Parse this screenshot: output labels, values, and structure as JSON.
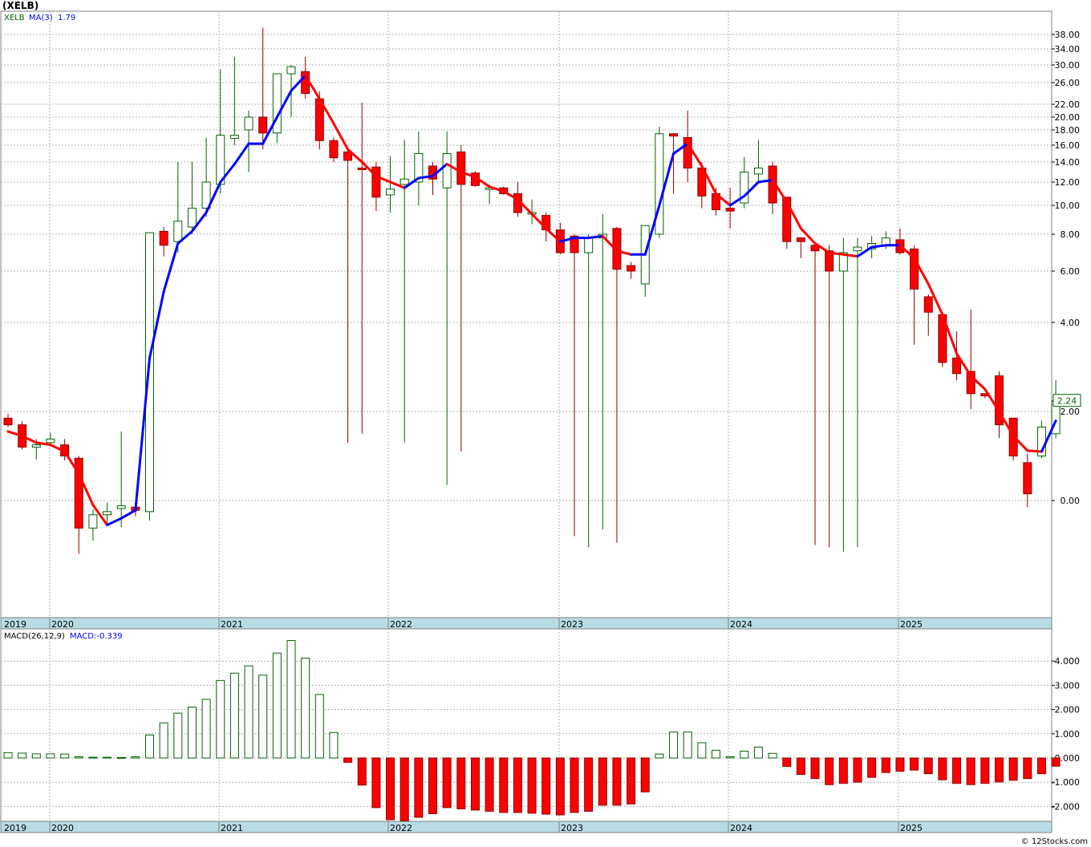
{
  "header": {
    "title": "(XELB)"
  },
  "credit": "© 12Stocks.com",
  "chart_data": [
    {
      "type": "candlestick",
      "ticker": "XELB",
      "ma_label": "MA(3)",
      "ma_value": "1.79",
      "last_price_label": "2.24",
      "y_scale": "custom-compressed",
      "y_ticks": [
        {
          "v": 0,
          "label": "0.00"
        },
        {
          "v": 2,
          "label": "2.00"
        },
        {
          "v": 4,
          "label": "4.00"
        },
        {
          "v": 6,
          "label": "6.00"
        },
        {
          "v": 8,
          "label": "8.00"
        },
        {
          "v": 10,
          "label": "10.00"
        },
        {
          "v": 12,
          "label": "12.00"
        },
        {
          "v": 14,
          "label": "14.00"
        },
        {
          "v": 16,
          "label": "16.00"
        },
        {
          "v": 18,
          "label": "18.00"
        },
        {
          "v": 20,
          "label": "20.00"
        },
        {
          "v": 22,
          "label": "22.00"
        },
        {
          "v": 26,
          "label": "26.00"
        },
        {
          "v": 30,
          "label": "30.00"
        },
        {
          "v": 34,
          "label": "34.00"
        },
        {
          "v": 38,
          "label": "38.00"
        }
      ],
      "x_labels": [
        "2019",
        "2020",
        "2021",
        "2022",
        "2023",
        "2024",
        "2025"
      ],
      "colors": {
        "up": "#006400",
        "down": "#ff0000",
        "ma_up": "#0000ff",
        "ma_down": "#ff0000",
        "grid": "#b0b0b0",
        "axis_band": "#b8dce4"
      },
      "candles": [
        [
          1.85,
          1.95,
          1.65,
          1.7
        ],
        [
          1.7,
          1.78,
          1.15,
          1.2
        ],
        [
          1.2,
          1.38,
          0.92,
          1.25
        ],
        [
          1.3,
          1.52,
          1.22,
          1.38
        ],
        [
          1.25,
          1.38,
          0.9,
          1.0
        ],
        [
          0.95,
          1.0,
          -1.2,
          -0.62
        ],
        [
          -0.62,
          -0.2,
          -0.9,
          -0.32
        ],
        [
          -0.32,
          -0.05,
          -0.55,
          -0.25
        ],
        [
          -0.18,
          1.55,
          -0.6,
          -0.12
        ],
        [
          -0.15,
          -0.05,
          -0.35,
          -0.22
        ],
        [
          -0.25,
          7.8,
          -0.45,
          8.1
        ],
        [
          8.2,
          8.5,
          6.8,
          7.4
        ],
        [
          7.6,
          14.0,
          7.0,
          8.9
        ],
        [
          8.5,
          14.0,
          8.0,
          9.8
        ],
        [
          9.8,
          17.0,
          9.2,
          12.0
        ],
        [
          11.8,
          29.0,
          11.0,
          17.3
        ],
        [
          16.9,
          32.0,
          16.0,
          17.3
        ],
        [
          18.0,
          21.0,
          13.0,
          20.0
        ],
        [
          20.0,
          40.0,
          15.5,
          17.6
        ],
        [
          17.6,
          28.0,
          16.3,
          28.0
        ],
        [
          28.0,
          30.0,
          20.0,
          29.6
        ],
        [
          28.5,
          32.0,
          23.0,
          24.0
        ],
        [
          23.0,
          24.4,
          15.5,
          16.6
        ],
        [
          16.6,
          17.0,
          14.0,
          14.5
        ],
        [
          15.2,
          15.5,
          1.3,
          14.2
        ],
        [
          13.4,
          22.3,
          1.5,
          13.3
        ],
        [
          13.5,
          14.0,
          9.6,
          10.7
        ],
        [
          10.9,
          14.7,
          9.5,
          11.4
        ],
        [
          11.8,
          16.7,
          1.3,
          12.3
        ],
        [
          12.0,
          17.8,
          10.0,
          15.0
        ],
        [
          13.6,
          14.0,
          10.9,
          12.3
        ],
        [
          11.5,
          17.8,
          0.35,
          15.0
        ],
        [
          15.2,
          16.0,
          1.1,
          11.8
        ],
        [
          12.9,
          13.1,
          11.6,
          11.7
        ],
        [
          11.5,
          11.8,
          10.1,
          11.5
        ],
        [
          11.5,
          11.6,
          10.9,
          11.0
        ],
        [
          11.0,
          12.0,
          9.2,
          9.5
        ],
        [
          9.5,
          10.5,
          8.7,
          9.5
        ],
        [
          9.3,
          9.5,
          7.6,
          8.3
        ],
        [
          8.3,
          8.8,
          6.9,
          7.0
        ],
        [
          7.9,
          8.0,
          -0.8,
          7.0
        ],
        [
          7.0,
          8.0,
          -1.05,
          7.8
        ],
        [
          7.8,
          9.4,
          -0.65,
          8.0
        ],
        [
          8.4,
          8.5,
          -0.95,
          6.1
        ],
        [
          6.3,
          6.5,
          5.7,
          6.0
        ],
        [
          5.5,
          8.4,
          5.0,
          8.6
        ],
        [
          8.0,
          18.5,
          7.8,
          17.5
        ],
        [
          17.5,
          17.6,
          11.0,
          17.2
        ],
        [
          17.0,
          21.0,
          12.0,
          13.4
        ],
        [
          13.4,
          14.0,
          9.8,
          10.8
        ],
        [
          11.0,
          11.5,
          9.3,
          9.7
        ],
        [
          9.8,
          11.5,
          8.4,
          9.6
        ],
        [
          10.2,
          14.6,
          9.8,
          13.0
        ],
        [
          12.8,
          16.7,
          12.0,
          13.4
        ],
        [
          13.6,
          14.0,
          9.4,
          10.2
        ],
        [
          10.7,
          10.7,
          7.2,
          7.6
        ],
        [
          7.8,
          7.8,
          6.7,
          7.6
        ],
        [
          7.4,
          7.5,
          -1.0,
          7.1
        ],
        [
          7.1,
          7.4,
          -1.05,
          6.0
        ],
        [
          6.0,
          7.8,
          -1.15,
          7.0
        ],
        [
          7.1,
          7.8,
          -1.05,
          7.3
        ],
        [
          7.2,
          7.9,
          6.7,
          7.5
        ],
        [
          7.4,
          8.2,
          7.2,
          7.8
        ],
        [
          7.7,
          8.4,
          6.9,
          7.0
        ],
        [
          7.2,
          7.4,
          3.5,
          5.3
        ],
        [
          5.0,
          5.1,
          3.7,
          4.4
        ],
        [
          4.3,
          4.4,
          3.0,
          3.1
        ],
        [
          3.2,
          3.8,
          2.7,
          2.85
        ],
        [
          2.9,
          4.5,
          2.05,
          2.4
        ],
        [
          2.4,
          2.4,
          2.3,
          2.35
        ],
        [
          2.8,
          2.9,
          1.4,
          1.7
        ],
        [
          1.85,
          1.85,
          0.9,
          1.0
        ],
        [
          0.85,
          1.05,
          -0.15,
          0.15
        ],
        [
          1.0,
          1.8,
          0.95,
          1.65
        ],
        [
          1.5,
          2.7,
          1.4,
          2.24
        ]
      ],
      "ma": [
        1.55,
        1.45,
        1.3,
        1.25,
        1.1,
        0.6,
        -0.1,
        -0.55,
        -0.4,
        -0.22,
        3.2,
        5.2,
        7.5,
        8.2,
        9.5,
        12.0,
        13.8,
        16.2,
        16.2,
        20.0,
        24.5,
        27.6,
        23.0,
        19.0,
        15.5,
        14.0,
        12.6,
        12.0,
        11.5,
        12.4,
        12.6,
        13.8,
        13.0,
        12.5,
        11.6,
        11.2,
        10.5,
        9.4,
        8.4,
        7.6,
        7.8,
        7.8,
        7.9,
        7.1,
        6.9,
        6.9,
        10.0,
        15.0,
        16.2,
        13.6,
        11.0,
        10.0,
        10.8,
        12.0,
        12.2,
        10.3,
        8.4,
        7.5,
        7.0,
        6.9,
        6.8,
        7.3,
        7.4,
        7.4,
        6.7,
        5.5,
        4.3,
        3.3,
        2.8,
        2.5,
        2.0,
        1.45,
        1.12,
        1.1,
        1.79
      ]
    },
    {
      "type": "bar",
      "label": "MACD(26,12,9)",
      "value_label": "MACD:-0.339",
      "y_ticks": [
        {
          "v": -2,
          "label": "-2.000"
        },
        {
          "v": -1,
          "label": "-1.000"
        },
        {
          "v": 0,
          "label": "0.000"
        },
        {
          "v": 1,
          "label": "1.000"
        },
        {
          "v": 2,
          "label": "2.000"
        },
        {
          "v": 3,
          "label": "3.000"
        },
        {
          "v": 4,
          "label": "4.000"
        }
      ],
      "x_labels": [
        "2019",
        "2020",
        "2021",
        "2022",
        "2023",
        "2024",
        "2025"
      ],
      "values": [
        0.22,
        0.2,
        0.17,
        0.17,
        0.16,
        0.05,
        0.03,
        0.03,
        0.02,
        0.05,
        0.95,
        1.45,
        1.85,
        2.1,
        2.42,
        3.2,
        3.5,
        3.8,
        3.42,
        4.33,
        4.85,
        4.12,
        2.62,
        1.05,
        -0.18,
        -1.12,
        -2.05,
        -2.55,
        -2.6,
        -2.45,
        -2.3,
        -2.05,
        -2.1,
        -2.15,
        -2.2,
        -2.25,
        -2.25,
        -2.28,
        -2.32,
        -2.35,
        -2.25,
        -2.2,
        -1.95,
        -1.95,
        -1.9,
        -1.4,
        0.16,
        1.07,
        1.07,
        0.63,
        0.32,
        0.05,
        0.28,
        0.45,
        0.19,
        -0.35,
        -0.68,
        -0.85,
        -1.1,
        -1.05,
        -1.0,
        -0.8,
        -0.6,
        -0.55,
        -0.5,
        -0.65,
        -0.9,
        -1.05,
        -1.1,
        -1.05,
        -0.99,
        -0.92,
        -0.85,
        -0.65,
        -0.34
      ]
    }
  ]
}
